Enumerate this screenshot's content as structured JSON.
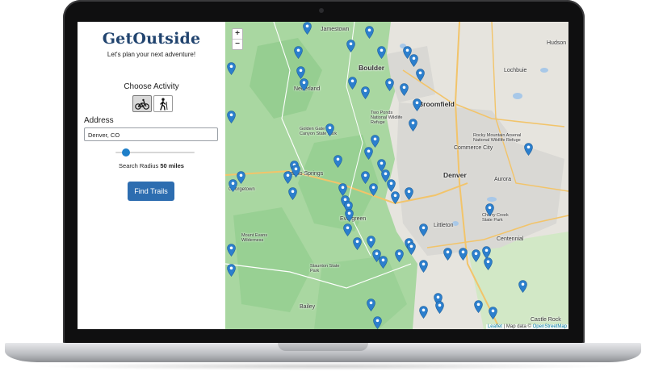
{
  "app": {
    "logo": "GetOutside",
    "tagline": "Let's plan your next adventure!"
  },
  "activity": {
    "label": "Choose Activity",
    "options": [
      {
        "name": "bike",
        "icon": "bicycle-icon",
        "selected": true
      },
      {
        "name": "hike",
        "icon": "hiker-icon",
        "selected": false
      }
    ]
  },
  "address": {
    "label": "Address",
    "value": "Denver, CO"
  },
  "radius": {
    "prefix": "Search Radius",
    "value": "50 miles",
    "level": 0.1
  },
  "find_button": "Find Trails",
  "map": {
    "zoom_in": "+",
    "zoom_out": "−",
    "attribution_leaflet": "Leaflet",
    "attribution_sep": " | Map data © ",
    "attribution_osm": "OpenStreetMap",
    "places": [
      {
        "name": "Jamestown",
        "big": false
      },
      {
        "name": "Boulder",
        "big": true
      },
      {
        "name": "Broomfield",
        "big": true
      },
      {
        "name": "Lochbuie",
        "big": false
      },
      {
        "name": "Hudson",
        "big": false
      },
      {
        "name": "Commerce City",
        "big": false
      },
      {
        "name": "Denver",
        "big": true
      },
      {
        "name": "Aurora",
        "big": false
      },
      {
        "name": "Littleton",
        "big": false
      },
      {
        "name": "Centennial",
        "big": false
      },
      {
        "name": "Castle Rock",
        "big": false
      },
      {
        "name": "Evergreen",
        "big": false
      },
      {
        "name": "Bailey",
        "big": false
      },
      {
        "name": "Nederland",
        "big": false
      },
      {
        "name": "Idaho Springs",
        "big": false
      },
      {
        "name": "Georgetown",
        "big": false
      },
      {
        "name": "Rocky Mountain Arsenal National Wildlife Refuge",
        "big": false
      },
      {
        "name": "Two Ponds National Wildlife Refuge",
        "big": false
      },
      {
        "name": "Golden Gate Canyon State Park",
        "big": false
      },
      {
        "name": "Staunton State Park",
        "big": false
      },
      {
        "name": "Mount Evans Wilderness",
        "big": false
      },
      {
        "name": "Cherry Creek State Park",
        "big": false
      }
    ],
    "colors": {
      "forest": "#a9d7a1",
      "forest_dark": "#8ecb8a",
      "urban": "#dcdcdc",
      "road": "#f7c96e",
      "water": "#a8c8e8",
      "marker": "#2c7fcd"
    }
  }
}
